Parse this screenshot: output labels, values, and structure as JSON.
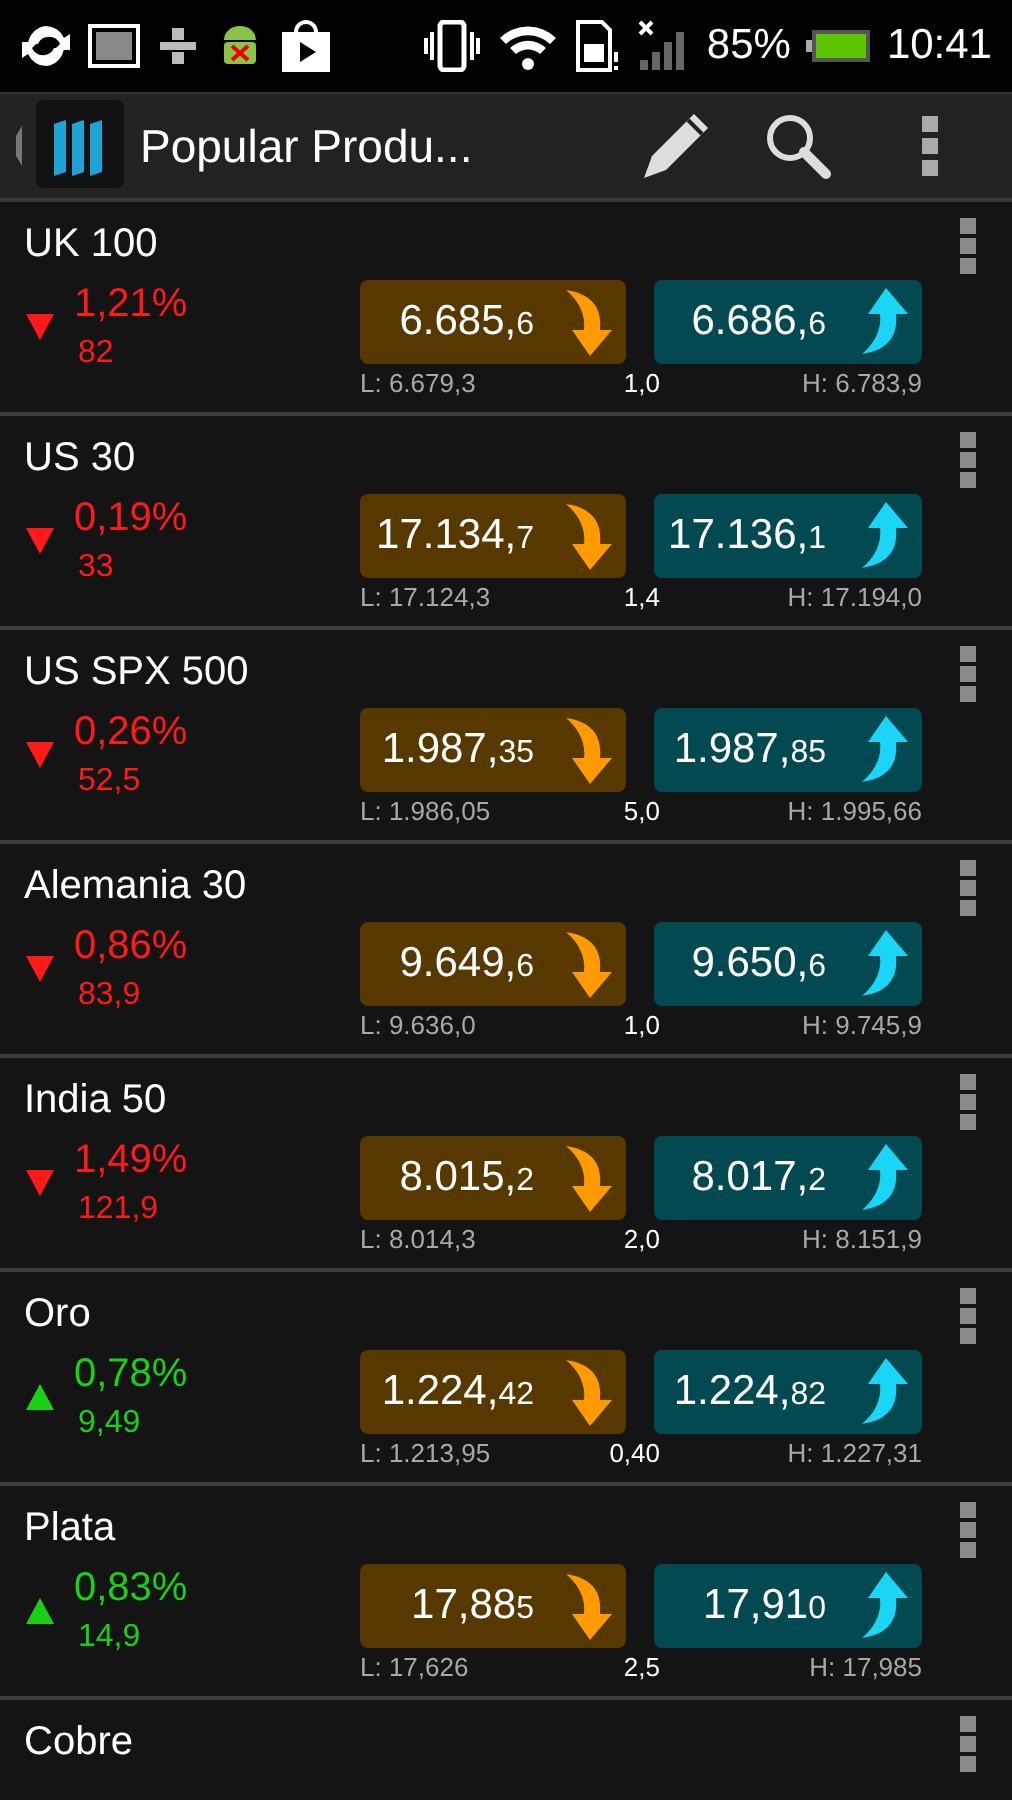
{
  "status_bar": {
    "battery": "85%",
    "time": "10:41"
  },
  "toolbar": {
    "title": "Popular Produ..."
  },
  "instruments": [
    {
      "name": "UK 100",
      "kind": "down",
      "percent": "1,21%",
      "change": "82",
      "sell": {
        "main": "6.685,",
        "tail": "6"
      },
      "buy": {
        "main": "6.686,",
        "tail": "6"
      },
      "low": "L: 6.679,3",
      "spread": "1,0",
      "high": "H: 6.783,9"
    },
    {
      "name": "US 30",
      "kind": "down",
      "percent": "0,19%",
      "change": "33",
      "sell": {
        "main": "17.134,",
        "tail": "7"
      },
      "buy": {
        "main": "17.136,",
        "tail": "1"
      },
      "low": "L: 17.124,3",
      "spread": "1,4",
      "high": "H: 17.194,0"
    },
    {
      "name": "US SPX 500",
      "kind": "down",
      "percent": "0,26%",
      "change": "52,5",
      "sell": {
        "main": "1.987,",
        "tail": "35"
      },
      "buy": {
        "main": "1.987,",
        "tail": "85"
      },
      "low": "L: 1.986,05",
      "spread": "5,0",
      "high": "H: 1.995,66"
    },
    {
      "name": "Alemania 30",
      "kind": "down",
      "percent": "0,86%",
      "change": "83,9",
      "sell": {
        "main": "9.649,",
        "tail": "6"
      },
      "buy": {
        "main": "9.650,",
        "tail": "6"
      },
      "low": "L: 9.636,0",
      "spread": "1,0",
      "high": "H: 9.745,9"
    },
    {
      "name": "India 50",
      "kind": "down",
      "percent": "1,49%",
      "change": "121,9",
      "sell": {
        "main": "8.015,",
        "tail": "2"
      },
      "buy": {
        "main": "8.017,",
        "tail": "2"
      },
      "low": "L: 8.014,3",
      "spread": "2,0",
      "high": "H: 8.151,9"
    },
    {
      "name": "Oro",
      "kind": "up",
      "percent": "0,78%",
      "change": "9,49",
      "sell": {
        "main": "1.224,",
        "tail": "42"
      },
      "buy": {
        "main": "1.224,",
        "tail": "82"
      },
      "low": "L: 1.213,95",
      "spread": "0,40",
      "high": "H: 1.227,31"
    },
    {
      "name": "Plata",
      "kind": "up",
      "percent": "0,83%",
      "change": "14,9",
      "sell": {
        "main": "17,88",
        "tail": "5"
      },
      "buy": {
        "main": "17,91",
        "tail": "0"
      },
      "low": "L: 17,626",
      "spread": "2,5",
      "high": "H: 17,985"
    },
    {
      "name": "Cobre"
    }
  ]
}
